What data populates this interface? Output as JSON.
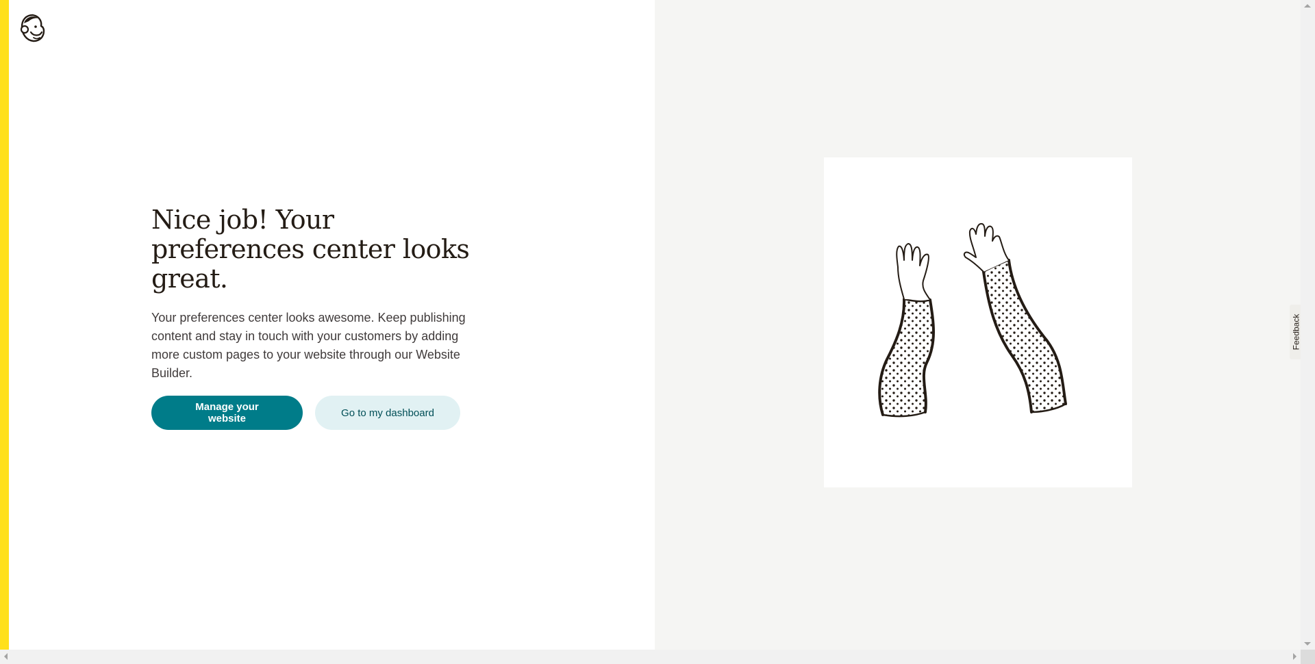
{
  "brand": {
    "logo_icon": "mailchimp-freddie-logo-icon",
    "accent_color": "#ffe01b"
  },
  "main": {
    "headline": "Nice job! Your preferences center looks great.",
    "description": "Your preferences center looks awesome. Keep publishing content and stay in touch with your customers by adding more custom pages to your website through our Website Builder."
  },
  "actions": {
    "primary_label": "Manage your website",
    "secondary_label": "Go to my dashboard",
    "primary_color": "#007c89",
    "secondary_color": "#e1f1f3"
  },
  "illustration": {
    "icon": "high-five-arms-illustration"
  },
  "feedback": {
    "label": "Feedback"
  }
}
